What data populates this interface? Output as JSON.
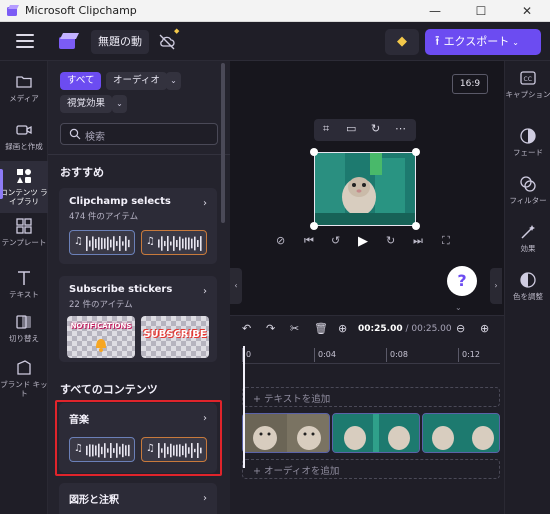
{
  "window": {
    "title": "Microsoft Clipchamp",
    "min": "—",
    "max": "☐",
    "close": "✕"
  },
  "topbar": {
    "project_name": "無題の動",
    "export_label": "エクスポート"
  },
  "leftnav": [
    {
      "label": "メディア",
      "icon": "folder-icon"
    },
    {
      "label": "録画と作成",
      "icon": "camera-icon"
    },
    {
      "label": "コンテンツ ライブラリ",
      "icon": "shapes-icon",
      "active": true
    },
    {
      "label": "テンプレート",
      "icon": "templates-icon"
    },
    {
      "label": "テキスト",
      "icon": "text-icon"
    },
    {
      "label": "切り替え",
      "icon": "transitions-icon"
    },
    {
      "label": "ブランド キット",
      "icon": "brand-kit-icon"
    }
  ],
  "panel": {
    "filters": {
      "all": "すべて",
      "audio": "オーディオ",
      "visual": "視覚効果"
    },
    "search_placeholder": "検索",
    "recommended_heading": "おすすめ",
    "cards": [
      {
        "title": "Clipchamp selects",
        "subtitle": "474 件のアイテム"
      },
      {
        "title": "Subscribe stickers",
        "subtitle": "22 件のアイテム"
      }
    ],
    "stickers": [
      "NOTIFICATIONS",
      "SUBSCRIBE"
    ],
    "all_content_heading": "すべてのコンテンツ",
    "music_card_title": "音楽",
    "shapes_card_title": "図形と注釈"
  },
  "preview": {
    "aspect_ratio": "16:9",
    "help": "?"
  },
  "timeline": {
    "current_time": "00:25.00",
    "total_time": "/ 00:25.00",
    "ruler": [
      "0",
      "0:04",
      "0:08",
      "0:12"
    ],
    "text_track": "+ テキストを追加",
    "audio_track": "+ オーディオを追加"
  },
  "rightnav": [
    {
      "label": "キャプション",
      "icon": "cc-icon"
    },
    {
      "label": "フェード",
      "icon": "fade-icon"
    },
    {
      "label": "フィルター",
      "icon": "filter-icon"
    },
    {
      "label": "効果",
      "icon": "effects-icon"
    },
    {
      "label": "色を調整",
      "icon": "color-adjust-icon"
    }
  ],
  "colors": {
    "accent": "#6c4cf1",
    "highlight_frame": "#e0242b",
    "premium": "#f3c84a"
  }
}
